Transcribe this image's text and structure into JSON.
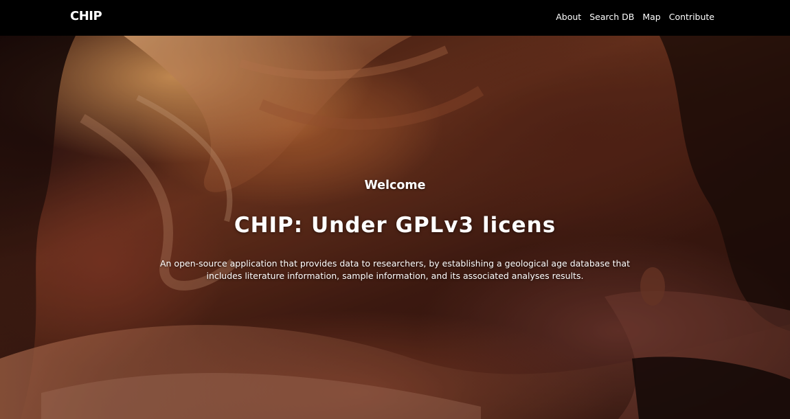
{
  "navbar": {
    "brand": "CHIP",
    "links": [
      {
        "label": "About"
      },
      {
        "label": "Search DB"
      },
      {
        "label": "Map"
      },
      {
        "label": "Contribute"
      }
    ]
  },
  "hero": {
    "welcome": "Welcome",
    "title": "CHIP: Under GPLv3 licens",
    "description": "An open-source application that provides data to researchers, by establishing a geological age database that includes literature information, sample information, and its associated analyses results."
  },
  "colors": {
    "navbar_bg": "#000000",
    "text": "#ffffff",
    "canyon_light": "#f0aa64",
    "canyon_mid": "#9a4a2a",
    "canyon_dark": "#2a110c"
  }
}
